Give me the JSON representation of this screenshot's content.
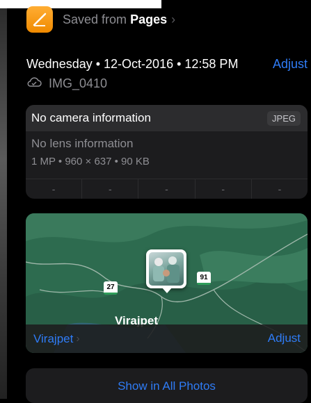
{
  "source": {
    "prefix": "Saved from",
    "app": "Pages"
  },
  "meta": {
    "datetime": "Wednesday • 12-Oct-2016 • 12:58 PM",
    "adjust_label": "Adjust",
    "filename": "IMG_0410"
  },
  "camera": {
    "title": "No camera information",
    "format": "JPEG",
    "lens": "No lens information",
    "specs": "1 MP  •  960 × 637  •  90 KB",
    "exif": [
      "-",
      "-",
      "-",
      "-",
      "-"
    ]
  },
  "map": {
    "town": "Virajpet",
    "roads": [
      "27",
      "91"
    ],
    "place": "Virajpet",
    "adjust_label": "Adjust"
  },
  "actions": {
    "show_all": "Show in All Photos"
  },
  "colors": {
    "accent": "#2f7cf6",
    "card": "#1c1c1e",
    "secondary_text": "#8e8e93"
  }
}
